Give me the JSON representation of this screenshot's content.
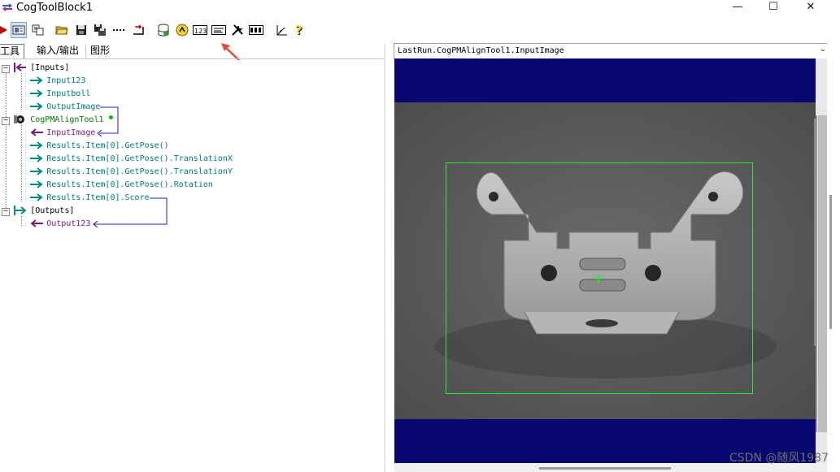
{
  "window": {
    "title": "CogToolBlock1",
    "minimize": "—",
    "maximize": "☐",
    "close": "✕"
  },
  "toolbar": {
    "buttons": [
      {
        "name": "run-icon"
      },
      {
        "name": "show-io-icon"
      },
      {
        "name": "add-terminal-icon"
      },
      {
        "name": "open-icon"
      },
      {
        "name": "save-icon"
      },
      {
        "name": "save-as-icon"
      },
      {
        "name": "dots-icon"
      },
      {
        "name": "reset-icon"
      },
      {
        "name": "database-icon"
      },
      {
        "name": "script-icon"
      },
      {
        "name": "value-icon"
      },
      {
        "name": "text-icon"
      },
      {
        "name": "tools-icon"
      },
      {
        "name": "debug-icon"
      },
      {
        "name": "accuracy-icon"
      },
      {
        "name": "help-icon"
      }
    ]
  },
  "tabs": [
    "工具",
    "输入/输出",
    "图形"
  ],
  "tree": {
    "inputs_header": "[Inputs]",
    "inputs": [
      "Input123",
      "Inputboll",
      "OutputImage"
    ],
    "tool_name": "CogPMAlignTool1",
    "tool_input": "InputImage",
    "tool_outputs": [
      "Results.Item[0].GetPose()",
      "Results.Item[0].GetPose().TranslationX",
      "Results.Item[0].GetPose().TranslationY",
      "Results.Item[0].GetPose().Rotation",
      "Results.Item[0].Score"
    ],
    "outputs_header": "[Outputs]",
    "outputs": [
      "Output123"
    ]
  },
  "image_panel": {
    "selector": "LastRun.CogPMAlignTool1.InputImage"
  },
  "colors": {
    "annotation_arrow": "#e8493d",
    "scribble": "#8b0e0e",
    "search_region": "#2ee82e",
    "display_background": "#080870"
  },
  "watermark": "CSDN @随风1987"
}
